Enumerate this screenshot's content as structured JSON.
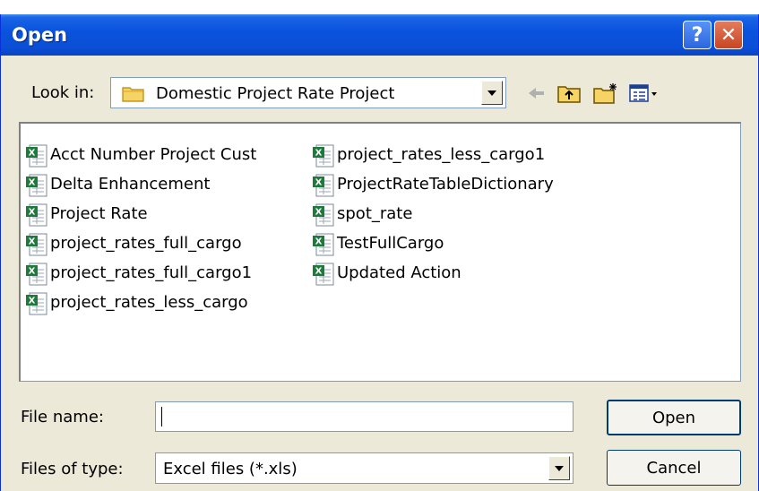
{
  "dialog": {
    "title": "Open",
    "look_in_label": "Look in:",
    "look_in_value": "Domestic Project Rate Project",
    "file_name_label": "File name:",
    "file_name_value": "",
    "files_of_type_label": "Files of type:",
    "files_of_type_value": "Excel files (*.xls)",
    "open_button": "Open",
    "cancel_button": "Cancel",
    "help_glyph": "?",
    "close_glyph": "✕"
  },
  "files": {
    "column1": [
      "Acct Number Project Cust",
      "Delta Enhancement",
      "Project Rate",
      "project_rates_full_cargo",
      "project_rates_full_cargo1",
      "project_rates_less_cargo"
    ],
    "column2": [
      "project_rates_less_cargo1",
      "ProjectRateTableDictionary",
      "spot_rate",
      "TestFullCargo",
      "Updated Action"
    ]
  },
  "icons": {
    "file": "excel-file-icon",
    "folder": "folder-icon",
    "back": "back-arrow-icon",
    "up": "up-folder-icon",
    "new_folder": "new-folder-icon",
    "views": "views-menu-icon"
  },
  "colors": {
    "titlebar": "#0a53dd",
    "dialog_bg": "#ece9d8",
    "close_button": "#c94521",
    "excel_green": "#1d7a3a"
  }
}
